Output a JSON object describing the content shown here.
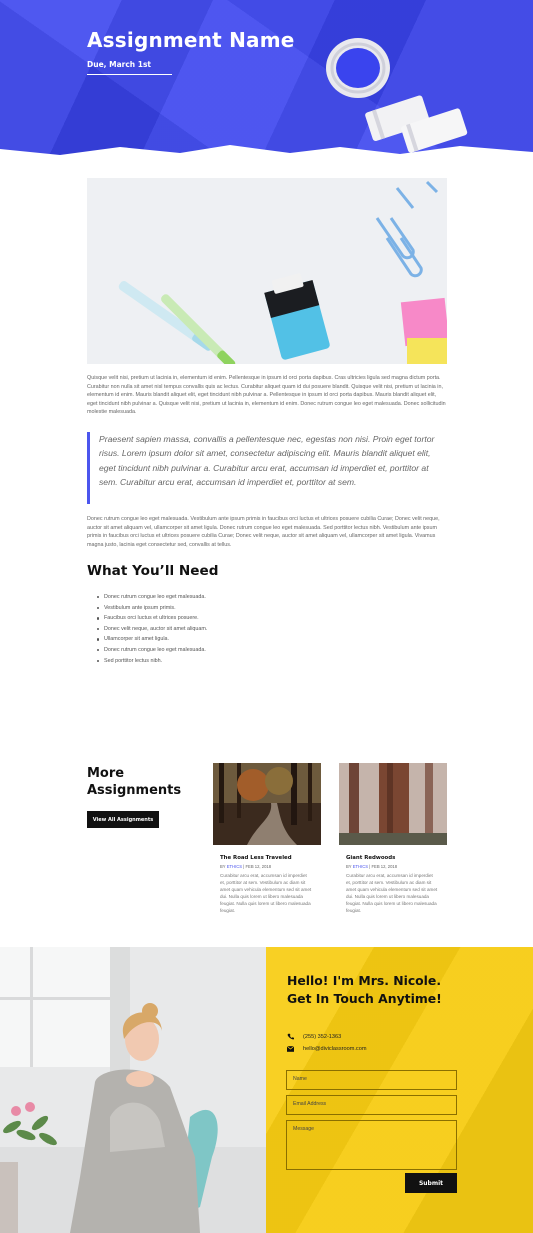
{
  "hero": {
    "title": "Assignment Name",
    "due": "Due, March 1st",
    "bg_color": "#3a44ee"
  },
  "article": {
    "paragraph1": "Quisque velit nisi, pretium ut lacinia in, elementum id enim. Pellentesque in ipsum id orci porta dapibus. Cras ultricies ligula sed magna dictum porta. Curabitur non nulla sit amet nisl tempus convallis quis ac lectus. Curabitur aliquet quam id dui posuere blandit. Quisque velit nisi, pretium ut lacinia in, elementum id enim. Mauris blandit aliquet elit, eget tincidunt nibh pulvinar a. Pellentesque in ipsum id orci porta dapibus. Mauris blandit aliquet elit, eget tincidunt nibh pulvinar a. Quisque velit nisi, pretium ut lacinia in, elementum id enim. Donec rutrum congue leo eget malesuada. Donec sollicitudin molestie malesuada.",
    "quote": "Praesent sapien massa, convallis a pellentesque nec, egestas non nisi. Proin eget tortor risus. Lorem ipsum dolor sit amet, consectetur adipiscing elit. Mauris blandit aliquet elit, eget tincidunt nibh pulvinar a. Curabitur arcu erat, accumsan id imperdiet et, porttitor at sem. Curabitur arcu erat, accumsan id imperdiet et, porttitor at sem.",
    "paragraph2": "Donec rutrum congue leo eget malesuada. Vestibulum ante ipsum primis in faucibus orci luctus et ultrices posuere cubilia Curae; Donec velit neque, auctor sit amet aliquam vel, ullamcorper sit amet ligula. Donec rutrum congue leo eget malesuada. Sed porttitor lectus nibh. Vestibulum ante ipsum primis in faucibus orci luctus et ultrices posuere cubilia Curae; Donec velit neque, auctor sit amet aliquam vel, ullamcorper sit amet ligula. Vivamus magna justo, lacinia eget consectetur sed, convallis at tellus.",
    "accent_color": "#4c56ee"
  },
  "needs": {
    "heading": "What You’ll Need",
    "items": [
      "Donec rutrum congue leo eget malesuada.",
      "Vestibulum ante ipsum primis.",
      "Faucibus orci luctus et ultrices posuere.",
      "Donec velit neque, auctor sit amet aliquam.",
      "Ullamcorper sit amet ligula.",
      "Donec rutrum congue leo eget malesuada.",
      "Sed porttitor lectus nibh."
    ]
  },
  "more": {
    "heading_line1": "More",
    "heading_line2": "Assignments",
    "view_all": "View All Assignments",
    "cards": [
      {
        "title": "The Road Less Traveled",
        "by": "BY",
        "author": "ETHICS",
        "date": "| FEB 12, 2018",
        "excerpt": "Curabitur arcu erat, accumsan id imperdiet et, porttitor at sem. Vestibulum ac diam sit amet quam vehicula elementum sed sit amet dui. Nulla quis lorem ut libero malesuada feugiat. Nulla quis lorem ut libero malesuada feugiat."
      },
      {
        "title": "Giant Redwoods",
        "by": "BY",
        "author": "ETHICS",
        "date": "| FEB 12, 2018",
        "excerpt": "Curabitur arcu erat, accumsan id imperdiet et, porttitor at sem. Vestibulum ac diam sit amet quam vehicula elementum sed sit amet dui. Nulla quis lorem ut libero malesuada feugiat. Nulla quis lorem ut libero malesuada feugiat."
      }
    ]
  },
  "contact": {
    "title": "Hello! I'm Mrs. Nicole. Get In Touch Anytime!",
    "phone": "(255) 352-1363",
    "email": "hello@diviclassroom.com",
    "name_placeholder": "Name",
    "email_placeholder": "Email Address",
    "message_placeholder": "Message",
    "submit": "Submit",
    "bg_color": "#f7cc13"
  }
}
